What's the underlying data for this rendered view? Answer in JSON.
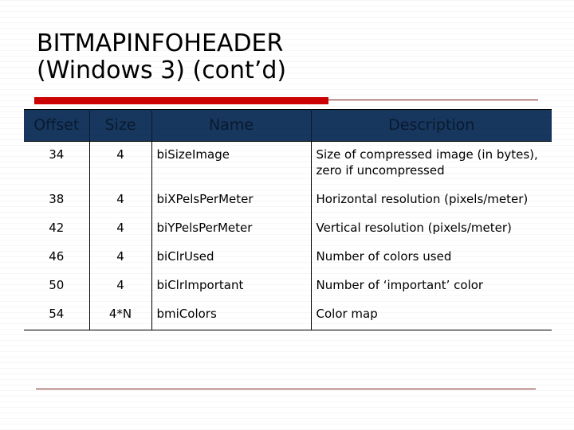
{
  "slide": {
    "title_lines": [
      "BITMAPINFOHEADER",
      "(Windows 3) (cont’d)"
    ],
    "accent_color": "#CC0000",
    "header_bg_color": "#17375E",
    "rule_color": "#7B1B1B"
  },
  "table": {
    "columns": [
      {
        "key": "offset",
        "label": "Offset"
      },
      {
        "key": "size",
        "label": "Size"
      },
      {
        "key": "name",
        "label": "Name"
      },
      {
        "key": "description",
        "label": "Description"
      }
    ],
    "rows": [
      {
        "offset": "34",
        "size": "4",
        "name": "biSizeImage",
        "description": "Size of compressed image (in bytes),  zero if uncompressed"
      },
      {
        "offset": "38",
        "size": "4",
        "name": "biXPelsPerMeter",
        "description": "Horizontal resolution (pixels/meter)"
      },
      {
        "offset": "42",
        "size": "4",
        "name": "biYPelsPerMeter",
        "description": "Vertical resolution (pixels/meter)"
      },
      {
        "offset": "46",
        "size": "4",
        "name": "biClrUsed",
        "description": "Number of colors used"
      },
      {
        "offset": "50",
        "size": "4",
        "name": "biClrImportant",
        "description": "Number of ‘important’ color"
      },
      {
        "offset": "54",
        "size": "4*N",
        "name": "bmiColors",
        "description": "Color map"
      }
    ]
  }
}
